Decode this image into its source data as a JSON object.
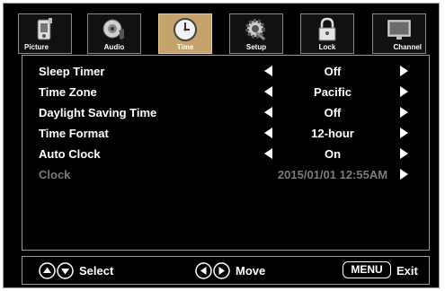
{
  "tabs": [
    {
      "label": "Picture",
      "icon": "picture-icon",
      "active": false
    },
    {
      "label": "Audio",
      "icon": "audio-icon",
      "active": false
    },
    {
      "label": "Time",
      "icon": "clock-icon",
      "active": true
    },
    {
      "label": "Setup",
      "icon": "setup-gear-icon",
      "active": false
    },
    {
      "label": "Lock",
      "icon": "lock-icon",
      "active": false
    },
    {
      "label": "Channel",
      "icon": "channel-tv-icon",
      "active": false
    }
  ],
  "settings": [
    {
      "label": "Sleep Timer",
      "value": "Off",
      "enabled": true
    },
    {
      "label": "Time Zone",
      "value": "Pacific",
      "enabled": true
    },
    {
      "label": "Daylight Saving Time",
      "value": "Off",
      "enabled": true
    },
    {
      "label": "Time Format",
      "value": "12-hour",
      "enabled": true
    },
    {
      "label": "Auto Clock",
      "value": "On",
      "enabled": true
    },
    {
      "label": "Clock",
      "value": "2015/01/01 12:55AM",
      "enabled": false
    }
  ],
  "footer": {
    "select_label": "Select",
    "move_label": "Move",
    "menu_key": "MENU",
    "exit_label": "Exit"
  },
  "colors": {
    "background": "#000000",
    "active_tab": "#c5a36a",
    "border": "#9a9a9a",
    "text": "#ffffff",
    "disabled_text": "#7a7a7a"
  }
}
